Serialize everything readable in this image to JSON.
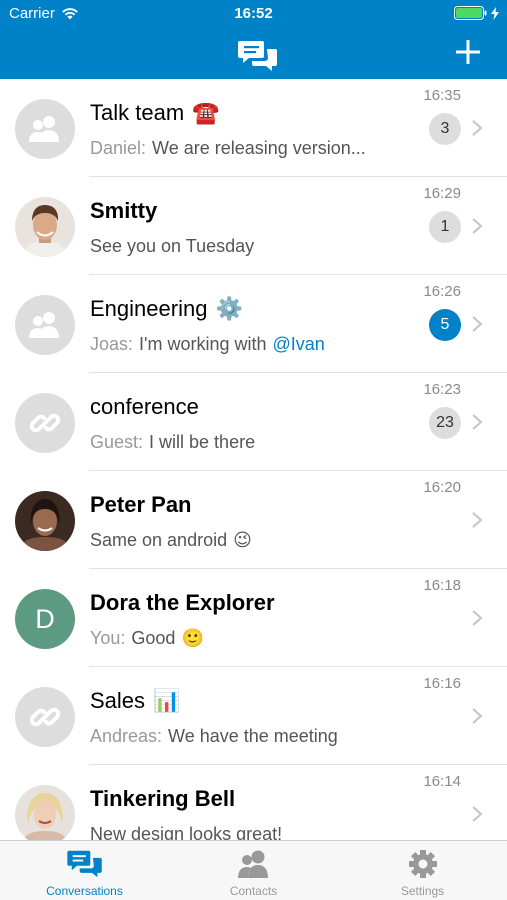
{
  "status_bar": {
    "carrier": "Carrier",
    "time": "16:52"
  },
  "colors": {
    "brand": "#0082c9",
    "badge_grey": "#dddddd",
    "avatar_green": "#5d9a82"
  },
  "header": {
    "logo_icon": "conversations-icon",
    "add_icon": "plus-icon"
  },
  "conversations": [
    {
      "title": "Talk team",
      "emoji": "☎️",
      "sender": "Daniel:",
      "message": "We are releasing version...",
      "time": "16:35",
      "unread": "3"
    },
    {
      "title": "Smitty",
      "emoji": "",
      "sender": "",
      "message": "See you on Tuesday",
      "time": "16:29",
      "unread": "1"
    },
    {
      "title": "Engineering",
      "emoji": "⚙️",
      "sender": "Joas:",
      "message": "I'm working with",
      "mention": "@Ivan",
      "time": "16:26",
      "unread": "5"
    },
    {
      "title": "conference",
      "emoji": "",
      "sender": "Guest:",
      "message": "I will be there",
      "time": "16:23",
      "unread": "23"
    },
    {
      "title": "Peter Pan",
      "emoji": "",
      "sender": "",
      "message": "Same on android",
      "message_emoji": "😉",
      "time": "16:20",
      "unread": ""
    },
    {
      "title": "Dora the Explorer",
      "emoji": "",
      "sender": "You:",
      "message": "Good",
      "message_emoji": "🙂",
      "time": "16:18",
      "unread": "",
      "avatar_letter": "D"
    },
    {
      "title": "Sales",
      "emoji": "📊",
      "sender": "Andreas:",
      "message": "We have the meeting",
      "time": "16:16",
      "unread": ""
    },
    {
      "title": "Tinkering Bell",
      "emoji": "",
      "sender": "",
      "message": "New design looks great!",
      "time": "16:14",
      "unread": ""
    }
  ],
  "tabs": [
    {
      "label": "Conversations",
      "icon": "conversations-icon",
      "active": true
    },
    {
      "label": "Contacts",
      "icon": "contacts-icon",
      "active": false
    },
    {
      "label": "Settings",
      "icon": "gear-icon",
      "active": false
    }
  ]
}
